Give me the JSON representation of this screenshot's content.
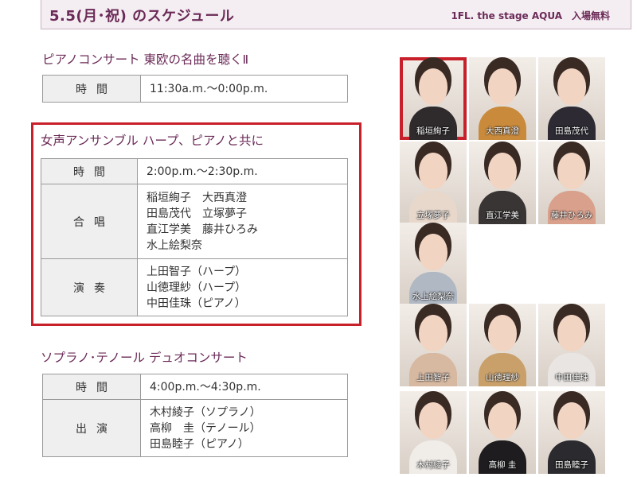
{
  "header": {
    "title": "5.5(月･祝) のスケジュール",
    "right": "1FL. the stage AQUA　入場無料"
  },
  "sections": [
    {
      "title": "ピアノコンサート 東欧の名曲を聴くⅡ",
      "rows": [
        {
          "label": "時間",
          "lines": [
            "11:30a.m.～0:00p.m."
          ]
        }
      ]
    },
    {
      "title": "女声アンサンブル ハープ、ピアノと共に",
      "rows": [
        {
          "label": "時間",
          "lines": [
            "2:00p.m.～2:30p.m."
          ]
        },
        {
          "label": "合唱",
          "lines": [
            "稲垣絢子　大西真澄",
            "田島茂代　立塚夢子",
            "直江学美　藤井ひろみ",
            "水上絵梨奈"
          ]
        },
        {
          "label": "演奏",
          "lines": [
            "上田智子（ハープ）",
            "山徳理紗（ハープ）",
            "中田佳珠（ピアノ）"
          ]
        }
      ]
    },
    {
      "title": "ソプラノ･テノール デュオコンサート",
      "rows": [
        {
          "label": "時間",
          "lines": [
            "4:00p.m.～4:30p.m."
          ]
        },
        {
          "label": "出演",
          "lines": [
            "木村綾子（ソプラノ）",
            "高柳　圭（テノール）",
            "田島睦子（ピアノ）"
          ]
        }
      ]
    }
  ],
  "photos": [
    {
      "name": "稲垣絢子",
      "selected": true
    },
    {
      "name": "大西真澄"
    },
    {
      "name": "田島茂代"
    },
    {
      "name": "立塚夢子"
    },
    {
      "name": "直江学美"
    },
    {
      "name": "藤井ひろみ"
    },
    {
      "name": "水上絵梨奈"
    },
    {
      "name": "上田智子"
    },
    {
      "name": "山徳理紗"
    },
    {
      "name": "中田佳珠"
    },
    {
      "name": "木村綾子"
    },
    {
      "name": "高柳 圭"
    },
    {
      "name": "田島睦子"
    }
  ],
  "colors": {
    "accent": "#6b2a57",
    "highlight": "#c8202a",
    "label_bg": "#efefef"
  }
}
